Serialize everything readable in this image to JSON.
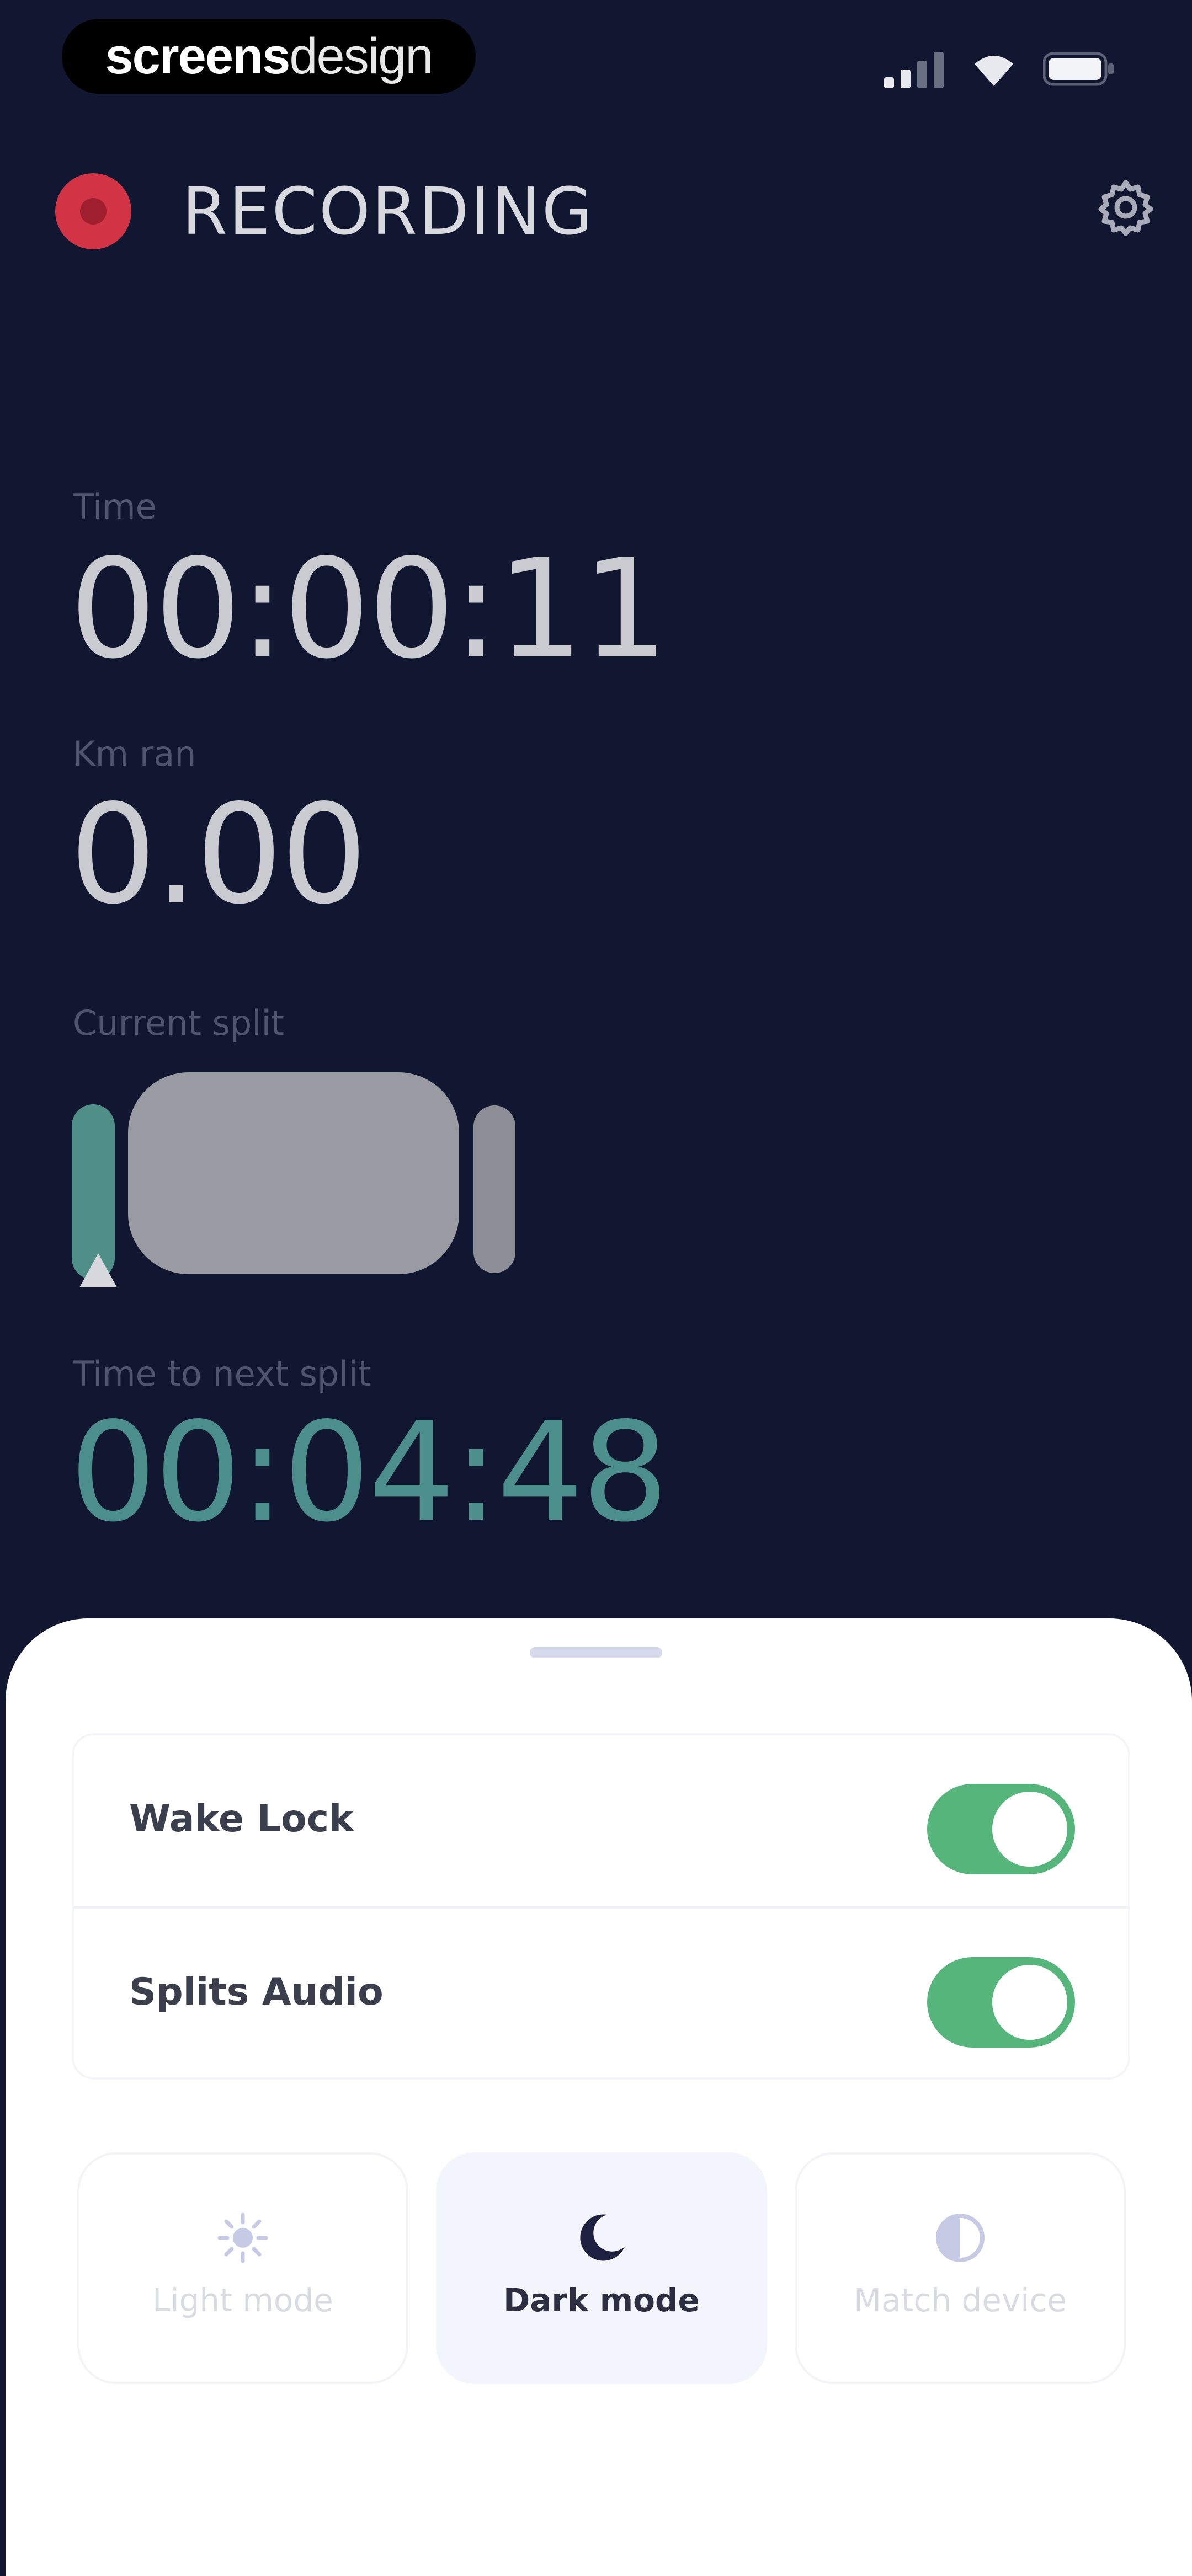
{
  "status_bar": {
    "brand_bold": "screens",
    "brand_light": "design",
    "icons": [
      "signal-icon",
      "wifi-icon",
      "battery-icon"
    ]
  },
  "header": {
    "title": "RECORDING",
    "record_color": "#d23345",
    "settings_icon": "gear-icon"
  },
  "metrics": {
    "time_label": "Time",
    "time_value": "00:00:11",
    "distance_label": "Km ran",
    "distance_value": "0.00",
    "current_split_label": "Current split",
    "next_split_label": "Time to next split",
    "next_split_value": "00:04:48",
    "accent_color": "#4c8e8b"
  },
  "sheet": {
    "settings": [
      {
        "label": "Wake Lock",
        "on": true
      },
      {
        "label": "Splits Audio",
        "on": true
      }
    ],
    "toggle_color": "#55b57b",
    "modes": [
      {
        "label": "Light mode",
        "icon": "sun-icon",
        "selected": false
      },
      {
        "label": "Dark mode",
        "icon": "moon-icon",
        "selected": true
      },
      {
        "label": "Match device",
        "icon": "half-circle-icon",
        "selected": false
      }
    ]
  }
}
